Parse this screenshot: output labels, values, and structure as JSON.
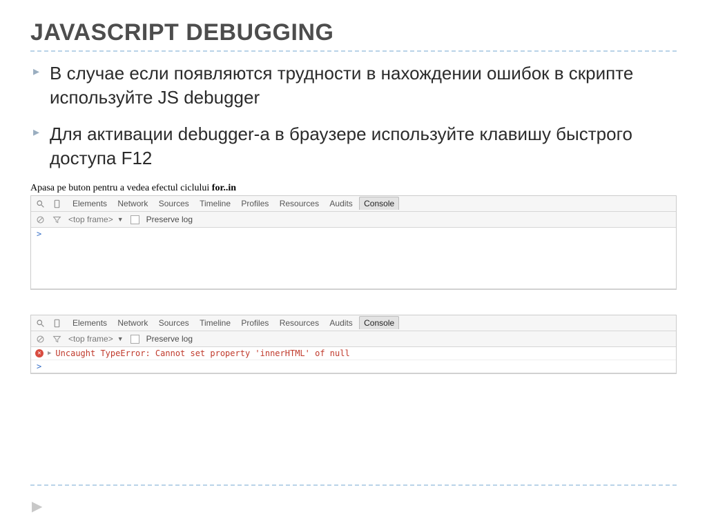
{
  "title": "JAVASCRIPT DEBUGGING",
  "bullets": [
    "В случае если появляются трудности в нахождении ошибок в скрипте используйте JS debugger",
    "Для активации debugger-а в браузере используйте клавишу быстрого доступа F12"
  ],
  "instruction_prefix": "Apasa pe buton pentru a vedea efectul ciclului ",
  "instruction_bold": "for..in",
  "devtools": {
    "tabs": [
      "Elements",
      "Network",
      "Sources",
      "Timeline",
      "Profiles",
      "Resources",
      "Audits",
      "Console"
    ],
    "active_tab": "Console",
    "frame_label": "<top frame>",
    "preserve_label": "Preserve log",
    "error_text": "Uncaught TypeError: Cannot set property 'innerHTML' of null",
    "prompt": ">"
  }
}
